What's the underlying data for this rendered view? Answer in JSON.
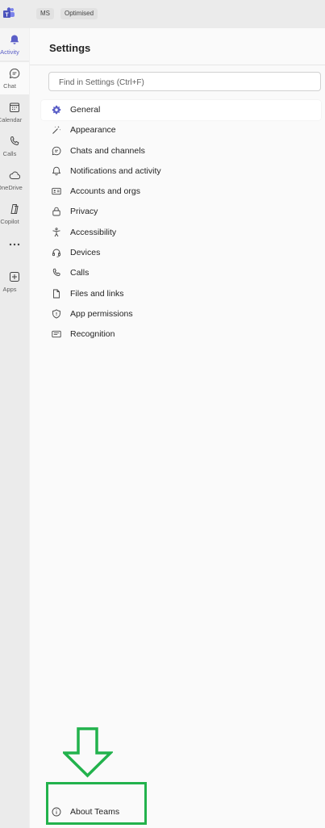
{
  "topbar": {
    "chip_ms": "MS",
    "chip_optimised": "Optimised"
  },
  "rail": {
    "items": [
      {
        "label": "Activity",
        "icon": "bell-icon"
      },
      {
        "label": "Chat",
        "icon": "chat-icon"
      },
      {
        "label": "Calendar",
        "icon": "calendar-icon"
      },
      {
        "label": "Calls",
        "icon": "phone-icon"
      },
      {
        "label": "OneDrive",
        "icon": "cloud-icon"
      },
      {
        "label": "Copilot",
        "icon": "copilot-icon"
      },
      {
        "label": "",
        "icon": "more-icon"
      },
      {
        "label": "Apps",
        "icon": "apps-icon"
      }
    ],
    "accent_color": "#5b5fc7"
  },
  "settings": {
    "title": "Settings",
    "search_placeholder": "Find in Settings (Ctrl+F)",
    "items": [
      {
        "label": "General",
        "icon": "gear-icon"
      },
      {
        "label": "Appearance",
        "icon": "magic-wand-icon"
      },
      {
        "label": "Chats and channels",
        "icon": "chat-bubble-icon"
      },
      {
        "label": "Notifications and activity",
        "icon": "bell-icon"
      },
      {
        "label": "Accounts and orgs",
        "icon": "id-card-icon"
      },
      {
        "label": "Privacy",
        "icon": "lock-icon"
      },
      {
        "label": "Accessibility",
        "icon": "accessibility-icon"
      },
      {
        "label": "Devices",
        "icon": "headset-icon"
      },
      {
        "label": "Calls",
        "icon": "phone-icon"
      },
      {
        "label": "Files and links",
        "icon": "document-icon"
      },
      {
        "label": "App permissions",
        "icon": "shield-icon"
      },
      {
        "label": "Recognition",
        "icon": "recognition-icon"
      }
    ],
    "about_label": "About Teams",
    "about_icon": "info-icon"
  },
  "annotation": {
    "color": "#22b24c"
  }
}
